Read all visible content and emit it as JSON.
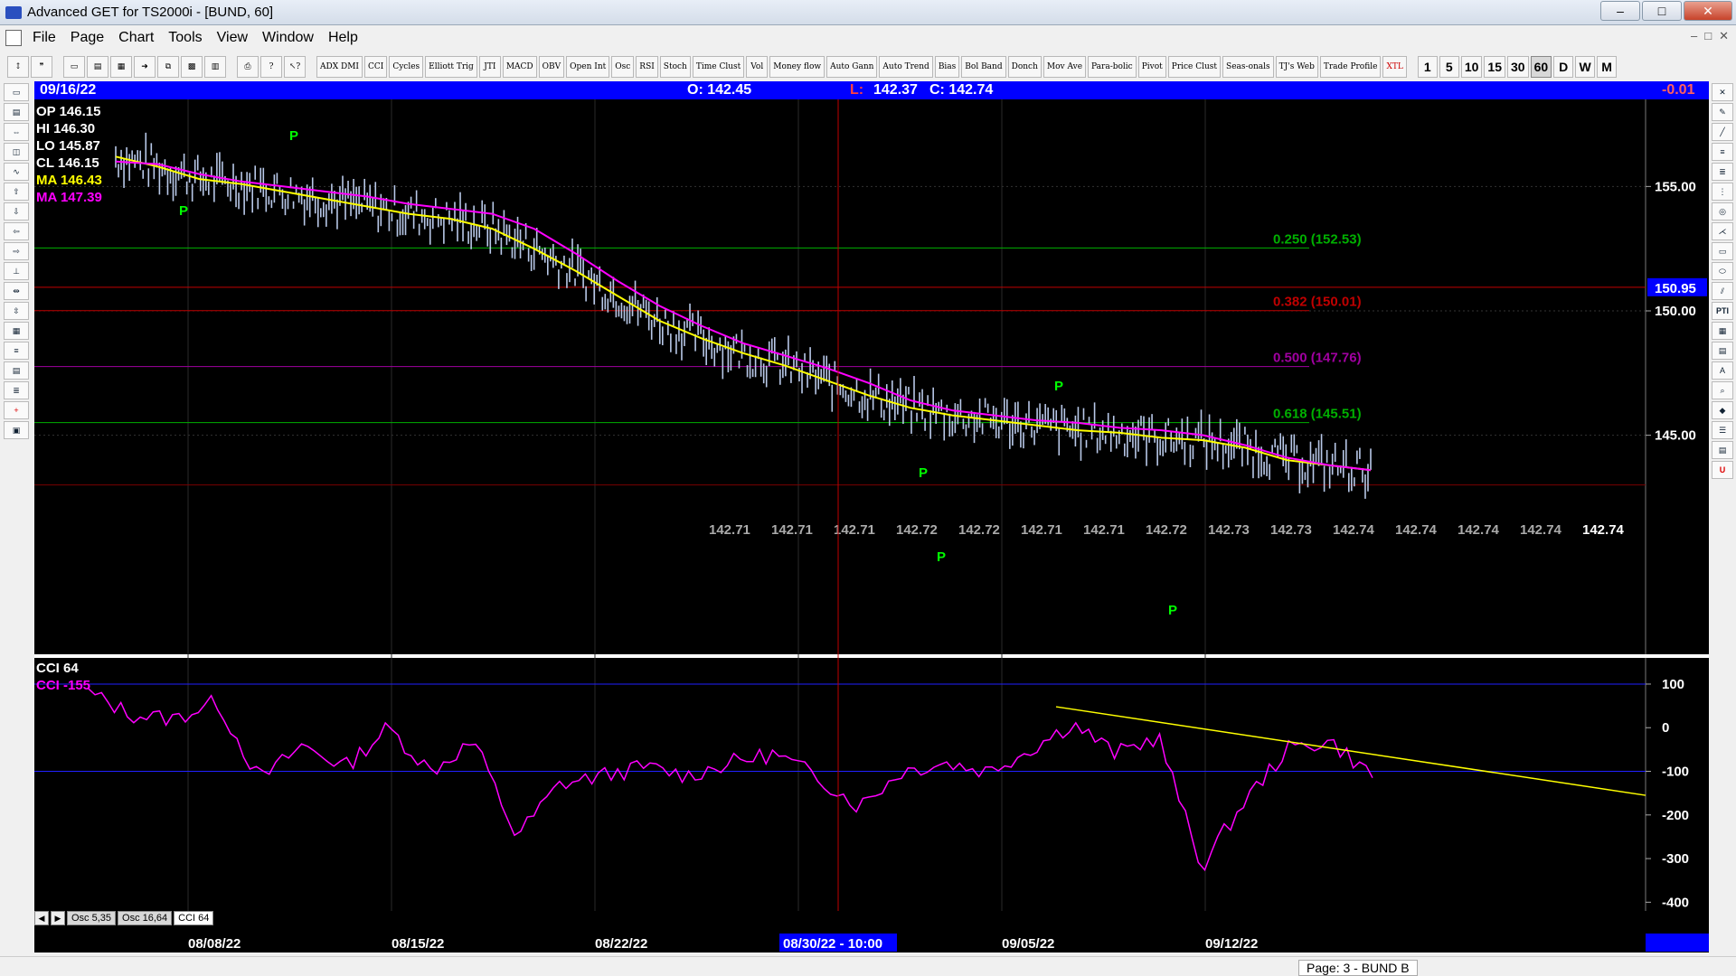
{
  "window": {
    "title": "Advanced GET for TS2000i - [BUND, 60]",
    "buttons": [
      "–",
      "□",
      "✕"
    ]
  },
  "menu": [
    "File",
    "Page",
    "Chart",
    "Tools",
    "View",
    "Window",
    "Help"
  ],
  "toolbar": {
    "studies": [
      "ADX DMI",
      "CCI",
      "Cycles",
      "Elliott Trig",
      "JTI",
      "MACD",
      "OBV",
      "Open Int",
      "Osc",
      "RSI",
      "Stoch",
      "Time Clust",
      "Vol",
      "Money flow",
      "Auto Gann",
      "Auto Trend",
      "Bias",
      "Bol Band",
      "Donch",
      "Mov Ave",
      "Para-bolic",
      "Pivot",
      "Price Clust",
      "Seas-onals",
      "TJ's Web",
      "Trade Profile",
      "XTL"
    ],
    "timeframes": [
      "1",
      "5",
      "10",
      "15",
      "30",
      "60",
      "D",
      "W",
      "M"
    ],
    "active_timeframe": "60"
  },
  "info_bar": {
    "date": "09/16/22",
    "open": "O: 142.45",
    "low_label": "L:",
    "low": "142.37",
    "close": "C: 142.74",
    "change": "-0.01"
  },
  "legend": {
    "op": "OP  146.15",
    "hi": "HI   146.30",
    "lo": "LO  145.87",
    "cl": "CL  146.15",
    "ma1": "MA  146.43",
    "ma2": "MA  147.39"
  },
  "price_axis": {
    "ticks": [
      "155.00",
      "150.00",
      "145.00"
    ],
    "marker": "150.95"
  },
  "fib_levels": [
    {
      "label": "0.250 (152.53)",
      "color": "#00b000"
    },
    {
      "label": "0.382 (150.01)",
      "color": "#c00000"
    },
    {
      "label": "0.500 (147.76)",
      "color": "#a000a0"
    },
    {
      "label": "0.618 (145.51)",
      "color": "#00b000"
    }
  ],
  "projection_values": [
    "142.71",
    "142.71",
    "142.71",
    "142.72",
    "142.72",
    "142.71",
    "142.71",
    "142.72",
    "142.73",
    "142.73",
    "142.74",
    "142.74",
    "142.74",
    "142.74"
  ],
  "last_projection": "142.74",
  "pivot_label": "P",
  "cci": {
    "title": "CCI 64",
    "value_label": "CCI  -155",
    "ticks": [
      "100",
      "0",
      "-100",
      "-200",
      "-300",
      "-400"
    ]
  },
  "dates": [
    "08/08/22",
    "08/15/22",
    "08/22/22",
    "08/30/22 - 10:00",
    "09/05/22",
    "09/12/22"
  ],
  "tabs": [
    "Osc 5,35",
    "Osc 16,64",
    "CCI 64"
  ],
  "status": {
    "page": "Page: 3 - BUND B"
  },
  "colors": {
    "background": "#000000",
    "bars": "#b8c8e8",
    "ma_fast": "#ffff00",
    "ma_slow": "#ff00ff",
    "info_bar": "#0000ff",
    "cursor": "#c00000"
  },
  "chart_data": {
    "type": "line",
    "title": "",
    "xlabel": "",
    "ylabel": "",
    "ylim": [
      140.7,
      158.5
    ],
    "series": [
      {
        "values": [
          156.2,
          155.8,
          155.3,
          155.1,
          154.8,
          154.5,
          154.2,
          153.9,
          153.7,
          153.3,
          152.5,
          151.6,
          150.6,
          149.6,
          148.9,
          148.3,
          147.8,
          147.2,
          146.6,
          146.1,
          145.8,
          145.6,
          145.4,
          145.2,
          145.1,
          144.9,
          144.8,
          144.5,
          144.0,
          143.8,
          143.6
        ]
      },
      {
        "values": [
          156.0,
          155.9,
          155.5,
          155.2,
          155.0,
          154.8,
          154.6,
          154.3,
          154.1,
          153.9,
          153.3,
          152.3,
          151.2,
          150.2,
          149.4,
          148.7,
          148.2,
          147.7,
          147.1,
          146.4,
          146.0,
          145.8,
          145.6,
          145.5,
          145.3,
          145.2,
          145.0,
          144.6,
          144.1,
          143.8,
          143.6
        ]
      },
      {
        "values": [
          80,
          30,
          20,
          60,
          -120,
          -40,
          -90,
          0,
          -100,
          -30,
          -250,
          -130,
          -110,
          -90,
          -110,
          -80,
          -60,
          -110,
          -180,
          -100,
          -80,
          -100,
          -50,
          10,
          -60,
          -20,
          -320,
          -170,
          -50,
          -30,
          -110
        ]
      }
    ]
  }
}
